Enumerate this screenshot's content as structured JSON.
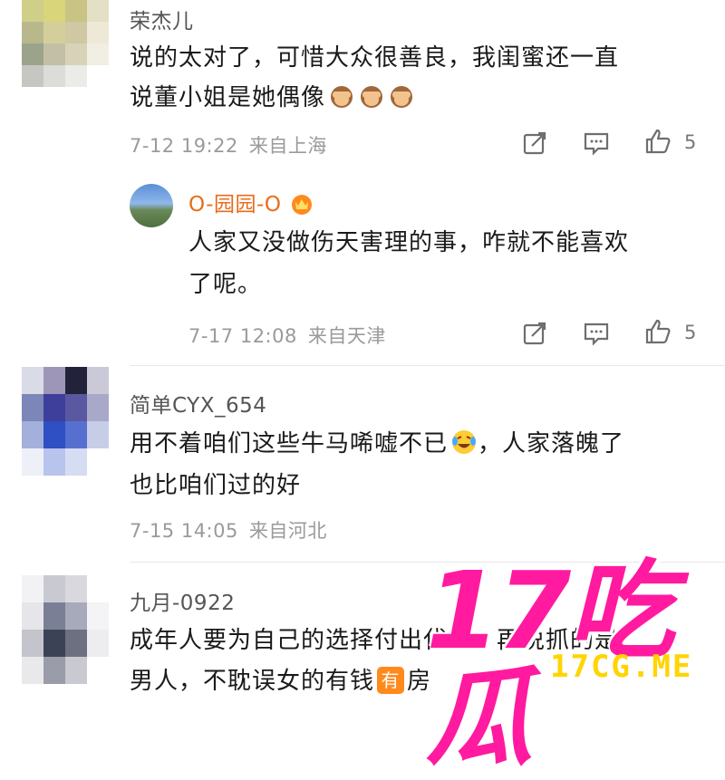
{
  "comments": [
    {
      "username": "荣杰儿",
      "text_line1": "说的太对了，可惜大众很善良，我闺蜜还一直",
      "text_line2": "说董小姐是她偶像",
      "emoji": "see-no-evil-monkey",
      "time": "7-12 19:22",
      "source": "来自上海",
      "likes": "5",
      "reply": {
        "username": "O-园园-O",
        "badge": "crown-badge",
        "text_line1": "人家又没做伤天害理的事，咋就不能喜欢",
        "text_line2": "了呢。",
        "time": "7-17 12:08",
        "source": "来自天津",
        "likes": "5"
      }
    },
    {
      "username": "简单CYX_654",
      "text_line1": "用不着咱们这些牛马唏嘘不已",
      "text_line1b": "，人家落魄了",
      "text_line2": "也比咱们过的好",
      "emoji": "crying-laughing-face",
      "time": "7-15 14:05",
      "source": "来自河北"
    },
    {
      "username": "九月-0922",
      "text_line1": "成年人要为自己的选择付出代价，再说抓的是",
      "text_line2a": "男人，不耽误女的有钱",
      "tag": "有",
      "text_line2b": "房"
    }
  ],
  "watermark": {
    "big": "17吃瓜",
    "url": "17CG.ME",
    "colors": {
      "pink": "#ff1aa0",
      "yellow": "#ffd400"
    }
  },
  "colors": {
    "orange_name": "#e86c1b",
    "meta_gray": "#9a9a9a",
    "icon_gray": "#6e6e6e"
  }
}
